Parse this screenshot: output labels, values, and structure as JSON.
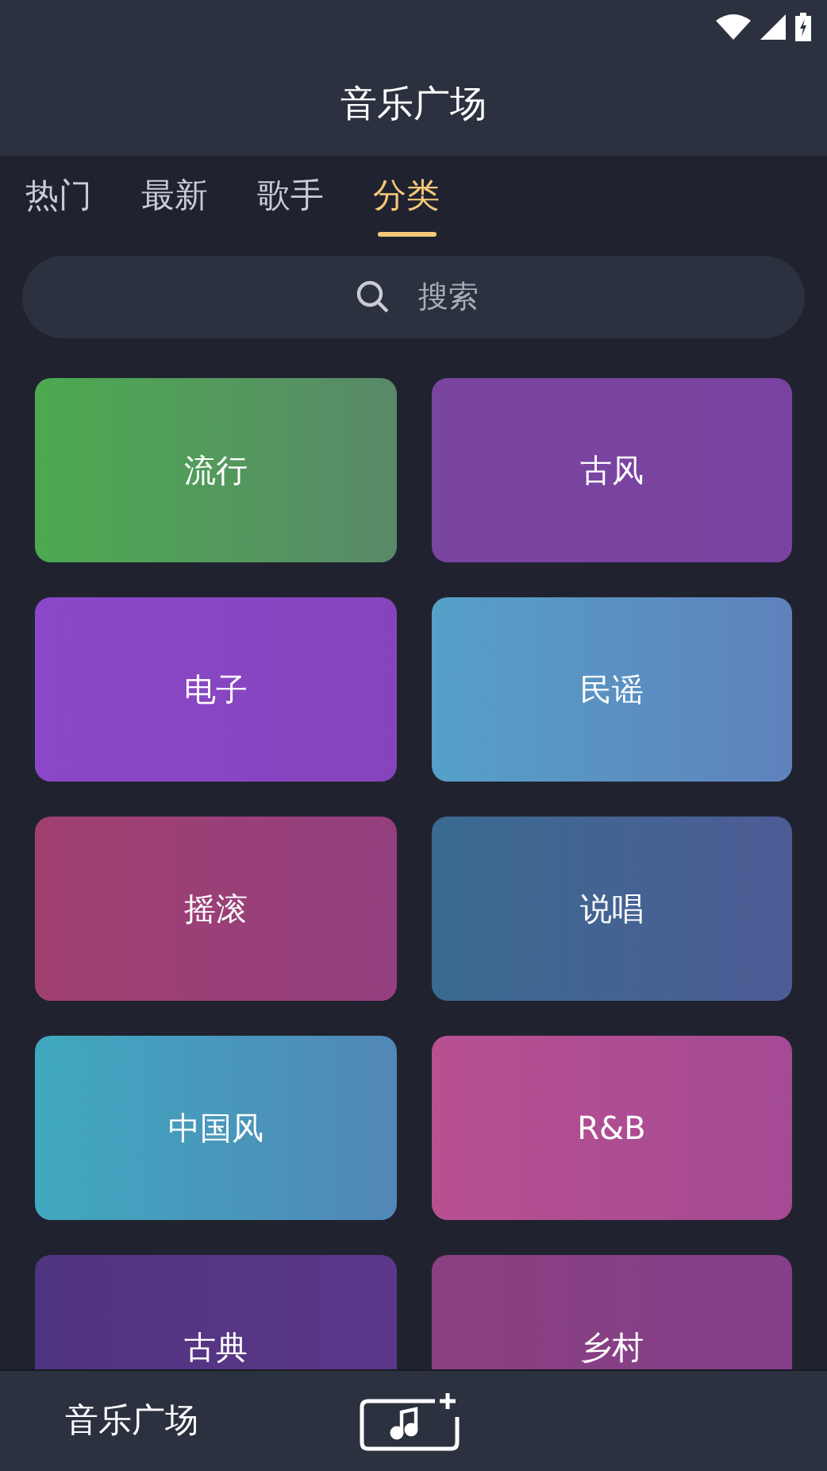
{
  "title": "音乐广场",
  "tabs": [
    {
      "label": "热门",
      "selected": false
    },
    {
      "label": "最新",
      "selected": false
    },
    {
      "label": "歌手",
      "selected": false
    },
    {
      "label": "分类",
      "selected": true
    }
  ],
  "search": {
    "placeholder": "搜索"
  },
  "categories": [
    {
      "label": "流行",
      "color": "#4caa50"
    },
    {
      "label": "古风",
      "color": "#7a45a0"
    },
    {
      "label": "电子",
      "color": "#8a48c8"
    },
    {
      "label": "民谣",
      "color": "#55a0c8"
    },
    {
      "label": "摇滚",
      "color": "#a04070"
    },
    {
      "label": "说唱",
      "color": "#3a6a90"
    },
    {
      "label": "中国风",
      "color": "#40a8c0"
    },
    {
      "label": "R&B",
      "color": "#b85090"
    },
    {
      "label": "古典",
      "color": "#4f347f"
    },
    {
      "label": "乡村",
      "color": "#8a4080"
    }
  ],
  "bottom_nav": {
    "label": "音乐广场"
  }
}
